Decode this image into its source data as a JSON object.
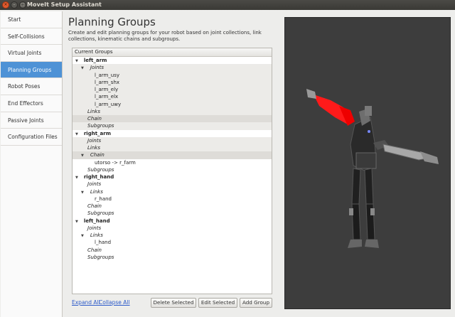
{
  "window": {
    "title": "MoveIt Setup Assistant",
    "buttons": [
      "×",
      "–",
      "□"
    ]
  },
  "sidebar": {
    "items": [
      {
        "label": "Start"
      },
      {
        "label": "Self-Collisions"
      },
      {
        "label": "Virtual Joints"
      },
      {
        "label": "Planning Groups"
      },
      {
        "label": "Robot Poses"
      },
      {
        "label": "End Effectors"
      },
      {
        "label": "Passive Joints"
      },
      {
        "label": "Configuration Files"
      }
    ],
    "active_index": 3
  },
  "page": {
    "title": "Planning Groups",
    "description": "Create and edit planning groups for your robot based on joint collections, link collections, kinematic chains and subgroups."
  },
  "tree": {
    "header": "Current Groups",
    "rows": [
      {
        "text": "left_arm",
        "kind": "group"
      },
      {
        "text": "Joints",
        "kind": "category"
      },
      {
        "text": "l_arm_usy",
        "kind": "item"
      },
      {
        "text": "l_arm_shx",
        "kind": "item"
      },
      {
        "text": "l_arm_ely",
        "kind": "item"
      },
      {
        "text": "l_arm_elx",
        "kind": "item"
      },
      {
        "text": "l_arm_uwy",
        "kind": "item"
      },
      {
        "text": "Links",
        "kind": "category"
      },
      {
        "text": "Chain",
        "kind": "category"
      },
      {
        "text": "Subgroups",
        "kind": "category"
      },
      {
        "text": "right_arm",
        "kind": "group"
      },
      {
        "text": "Joints",
        "kind": "category"
      },
      {
        "text": "Links",
        "kind": "category"
      },
      {
        "text": "Chain",
        "kind": "category"
      },
      {
        "text": "utorso  ->  r_farm",
        "kind": "item"
      },
      {
        "text": "Subgroups",
        "kind": "category"
      },
      {
        "text": "right_hand",
        "kind": "group"
      },
      {
        "text": "Joints",
        "kind": "category"
      },
      {
        "text": "Links",
        "kind": "category"
      },
      {
        "text": "r_hand",
        "kind": "item"
      },
      {
        "text": "Chain",
        "kind": "category"
      },
      {
        "text": "Subgroups",
        "kind": "category"
      },
      {
        "text": "left_hand",
        "kind": "group"
      },
      {
        "text": "Joints",
        "kind": "category"
      },
      {
        "text": "Links",
        "kind": "category"
      },
      {
        "text": "l_hand",
        "kind": "item"
      },
      {
        "text": "Chain",
        "kind": "category"
      },
      {
        "text": "Subgroups",
        "kind": "category"
      }
    ]
  },
  "actions": {
    "expand_all": "Expand All",
    "collapse_all": "Collapse All",
    "delete_selected": "Delete Selected",
    "edit_selected": "Edit Selected",
    "add_group": "Add Group"
  },
  "colors": {
    "accent": "#4e92d6",
    "highlight": "#ff1a1a",
    "viewport_bg": "#3d3d3d"
  }
}
